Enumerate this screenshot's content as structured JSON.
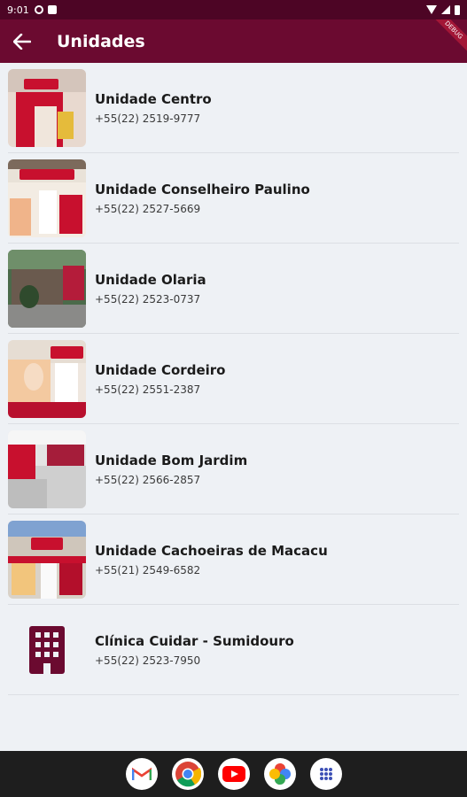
{
  "status_bar": {
    "time": "9:01"
  },
  "app_bar": {
    "title": "Unidades",
    "debug_label": "DEBUG"
  },
  "units": [
    {
      "name": "Unidade Centro",
      "phone": "+55(22) 2519-9777"
    },
    {
      "name": "Unidade Conselheiro Paulino",
      "phone": "+55(22) 2527-5669"
    },
    {
      "name": "Unidade Olaria",
      "phone": "+55(22) 2523-0737"
    },
    {
      "name": "Unidade Cordeiro",
      "phone": "+55(22) 2551-2387"
    },
    {
      "name": "Unidade Bom Jardim",
      "phone": "+55(22) 2566-2857"
    },
    {
      "name": "Unidade Cachoeiras de Macacu",
      "phone": "+55(21) 2549-6582"
    }
  ],
  "clinic": {
    "name": "Clínica Cuidar - Sumidouro",
    "phone": "+55(22) 2523-7950",
    "icon": "building-icon"
  },
  "colors": {
    "app_bar": "#6b0a30",
    "status_bar": "#4d0525",
    "accent": "#6b0a30",
    "background": "#eef1f5"
  },
  "nav_apps": [
    "gmail-icon",
    "chrome-icon",
    "youtube-icon",
    "photos-icon",
    "app-drawer-icon"
  ]
}
